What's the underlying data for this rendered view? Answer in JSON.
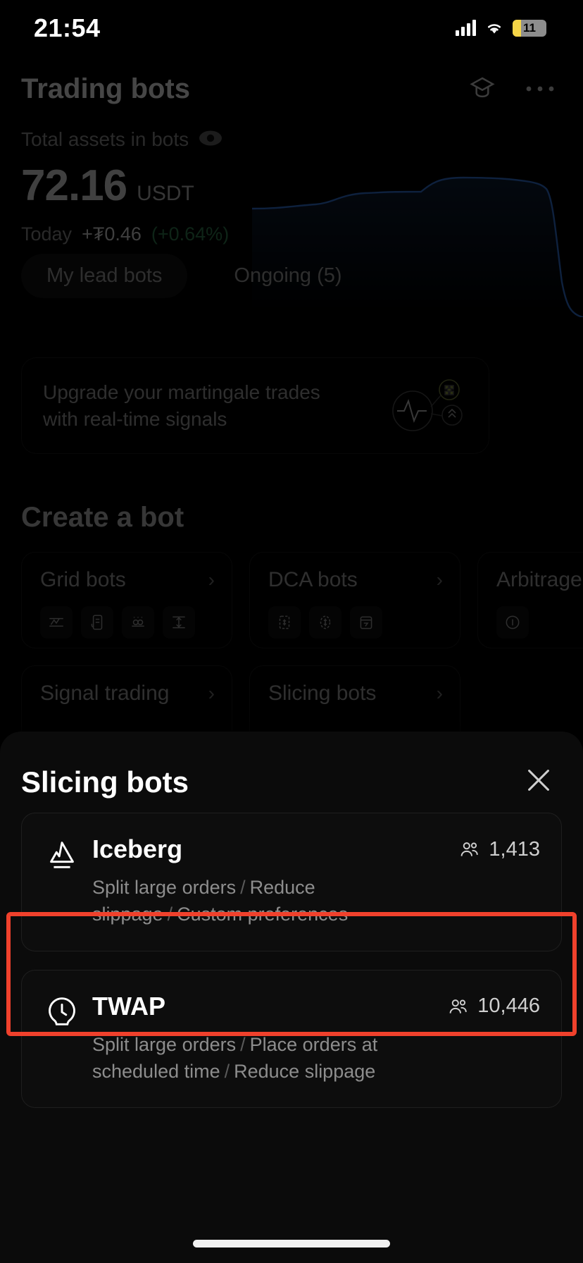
{
  "status_bar": {
    "time": "21:54",
    "battery_level": "11",
    "icons": [
      "cellular-signal-icon",
      "wifi-icon",
      "battery-icon"
    ]
  },
  "header": {
    "title": "Trading bots",
    "actions": [
      {
        "name": "graduation-cap-icon",
        "label": "Tutorials"
      },
      {
        "name": "more-options-icon",
        "label": "···"
      }
    ]
  },
  "assets": {
    "label": "Total assets in bots",
    "eye_icon": "eye-icon",
    "amount": "72.16",
    "unit": "USDT",
    "today_label": "Today",
    "today_change": "+₮0.46",
    "today_percent": "(+0.64%)",
    "percent_color": "#2f7a4e"
  },
  "chips": [
    {
      "label": "My lead bots",
      "filled": true
    },
    {
      "label": "Ongoing (5)",
      "filled": false
    }
  ],
  "banner": {
    "text": "Upgrade your martingale trades with real-time signals",
    "art_icon": "signal-pulse-icon"
  },
  "create_section": {
    "title": "Create a bot",
    "cards": [
      {
        "title": "Grid bots",
        "chevron": "›",
        "icons": [
          "spot-grid-icon",
          "futures-grid-icon",
          "infinity-grid-icon",
          "moving-grid-icon"
        ]
      },
      {
        "title": "DCA bots",
        "chevron": "›",
        "icons": [
          "spot-dca-icon",
          "futures-dca-icon",
          "recurring-buy-icon"
        ]
      },
      {
        "title": "Arbitrage bots",
        "chevron": "›",
        "icons": [
          "funding-arb-icon"
        ]
      },
      {
        "title": "Signal trading",
        "chevron": "›",
        "icons": []
      },
      {
        "title": "Slicing bots",
        "chevron": "›",
        "icons": []
      }
    ]
  },
  "sheet": {
    "title": "Slicing bots",
    "close_icon": "close-icon",
    "items": [
      {
        "icon": "iceberg-icon",
        "name": "Iceberg",
        "users_icon": "users-icon",
        "users": "1,413",
        "tags": [
          "Split large orders",
          "Reduce slippage",
          "Custom preferences"
        ],
        "highlighted": true
      },
      {
        "icon": "clock-icon",
        "name": "TWAP",
        "users_icon": "users-icon",
        "users": "10,446",
        "tags": [
          "Split large orders",
          "Place orders at scheduled time",
          "Reduce slippage"
        ],
        "highlighted": false
      }
    ]
  },
  "highlight": {
    "color": "#f0412c"
  }
}
